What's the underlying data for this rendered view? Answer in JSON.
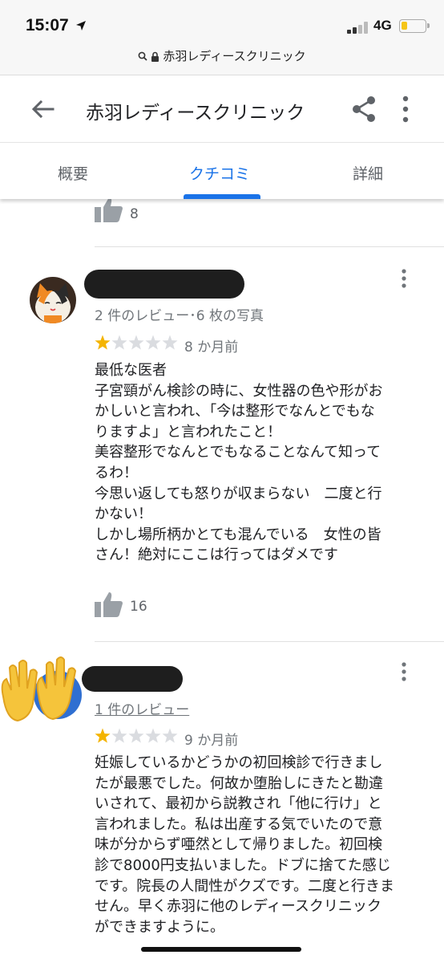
{
  "status": {
    "time": "15:07",
    "network": "4G",
    "battery_level": 0.25
  },
  "browser": {
    "url": "赤羽レディースクリニック"
  },
  "header": {
    "title": "赤羽レディースクリニック"
  },
  "tabs": [
    {
      "label": "概要",
      "active": false
    },
    {
      "label": "クチコミ",
      "active": true
    },
    {
      "label": "詳細",
      "active": false
    }
  ],
  "prev_review": {
    "likes": "8"
  },
  "reviews": [
    {
      "meta": "2 件のレビュー･6 枚の写真",
      "rating": 1,
      "age": "8 か月前",
      "text": "最低な医者\n子宮頸がん検診の時に、女性器の色や形がお\nかしいと言われ、「今は整形でなんとでもな\nりますよ」と言われたこと！\n美容整形でなんとでもなることなんて知って\nるわ！\n今思い返しても怒りが収まらない　二度と行\nかない！\nしかし場所柄かとても混んでいる　女性の皆\nさん！絶対にここは行ってはダメです",
      "likes": "16"
    },
    {
      "meta": "1 件のレビュー",
      "rating": 1,
      "age": "9 か月前",
      "text": "妊娠しているかどうかの初回検診で行きまし\nたが最悪でした。何故か堕胎しにきたと勘違\nいされて、最初から説教され「他に行け」と\n言われました。私は出産する気でいたので意\n味が分からず唖然として帰りました。初回検\n診で8000円支払いました。ドブに捨てた感じ\nです。院長の人間性がクズです。二度と行きま\nせん。早く赤羽に他のレディースクリニック\nができますように。"
    }
  ]
}
